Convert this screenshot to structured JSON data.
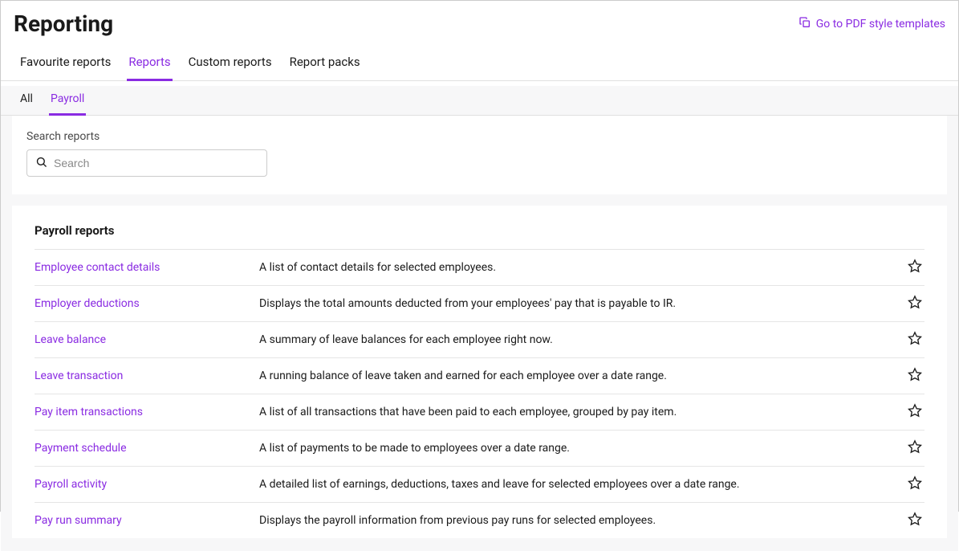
{
  "header": {
    "title": "Reporting",
    "pdf_link_label": "Go to PDF style templates"
  },
  "tabs": [
    {
      "label": "Favourite reports",
      "active": false
    },
    {
      "label": "Reports",
      "active": true
    },
    {
      "label": "Custom reports",
      "active": false
    },
    {
      "label": "Report packs",
      "active": false
    }
  ],
  "subtabs": [
    {
      "label": "All",
      "active": false
    },
    {
      "label": "Payroll",
      "active": true
    }
  ],
  "search": {
    "label": "Search reports",
    "placeholder": "Search",
    "value": ""
  },
  "section": {
    "heading": "Payroll reports",
    "rows": [
      {
        "name": "Employee contact details",
        "desc": "A list of contact details for selected employees."
      },
      {
        "name": "Employer deductions",
        "desc": "Displays the total amounts deducted from your employees' pay that is payable to IR."
      },
      {
        "name": "Leave balance",
        "desc": "A summary of leave balances for each employee right now."
      },
      {
        "name": "Leave transaction",
        "desc": "A running balance of leave taken and earned for each employee over a date range."
      },
      {
        "name": "Pay item transactions",
        "desc": "A list of all transactions that have been paid to each employee, grouped by pay item."
      },
      {
        "name": "Payment schedule",
        "desc": "A list of payments to be made to employees over a date range."
      },
      {
        "name": "Payroll activity",
        "desc": "A detailed list of earnings, deductions, taxes and leave for selected employees over a date range."
      },
      {
        "name": "Pay run summary",
        "desc": "Displays the payroll information from previous pay runs for selected employees."
      }
    ]
  }
}
